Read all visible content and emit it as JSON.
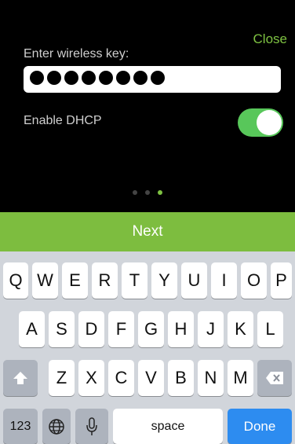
{
  "header": {
    "close_label": "Close"
  },
  "form": {
    "key_label": "Enter wireless key:",
    "key_masked_length": 8,
    "dhcp_label": "Enable DHCP",
    "dhcp_enabled": true
  },
  "pager": {
    "count": 3,
    "active": 3
  },
  "next_label": "Next",
  "keyboard": {
    "row1": [
      "Q",
      "W",
      "E",
      "R",
      "T",
      "Y",
      "U",
      "I",
      "O",
      "P"
    ],
    "row2": [
      "A",
      "S",
      "D",
      "F",
      "G",
      "H",
      "J",
      "K",
      "L"
    ],
    "row3": [
      "Z",
      "X",
      "C",
      "V",
      "B",
      "N",
      "M"
    ],
    "numbers_label": "123",
    "space_label": "space",
    "done_label": "Done"
  },
  "colors": {
    "accent": "#7dbd3f",
    "toggle_on": "#58c75a",
    "done_blue": "#2d8cf0"
  }
}
